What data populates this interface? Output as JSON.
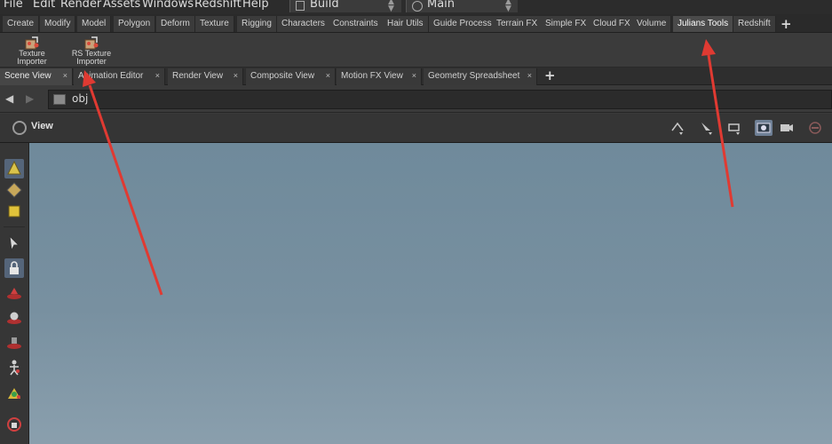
{
  "menubar": {
    "items": [
      "File",
      "Edit",
      "Render",
      "Assets",
      "Windows",
      "Redshift",
      "Help"
    ],
    "desktop": "Build",
    "context": "Main"
  },
  "shelf_tabs": [
    "Create",
    "Modify",
    "Model",
    "Polygon",
    "Deform",
    "Texture",
    "Rigging",
    "Characters",
    "Constraints",
    "Hair Utils",
    "Guide Process",
    "Terrain FX",
    "Simple FX",
    "Cloud FX",
    "Volume",
    "Julians Tools",
    "Redshift"
  ],
  "active_shelf_tab": "Julians Tools",
  "shelf_tools": [
    {
      "line1": "Texture",
      "line2": "Importer",
      "icon": "texture-importer-icon"
    },
    {
      "line1": "RS Texture",
      "line2": "Importer",
      "icon": "rs-texture-importer-icon"
    }
  ],
  "pane_tabs": [
    "Scene View",
    "Animation Editor",
    "Render View",
    "Composite View",
    "Motion FX View",
    "Geometry Spreadsheet"
  ],
  "active_pane_tab": "Scene View",
  "tab_close_glyph": "×",
  "path": {
    "value": "obj"
  },
  "viewer": {
    "title": "View"
  },
  "colors": {
    "annotation_arrow": "#e03a32",
    "viewport_top": "#6f8a9b",
    "viewport_bottom": "#8a9fad",
    "active_tab": "#4a4a4a",
    "selection": "#55657a"
  }
}
